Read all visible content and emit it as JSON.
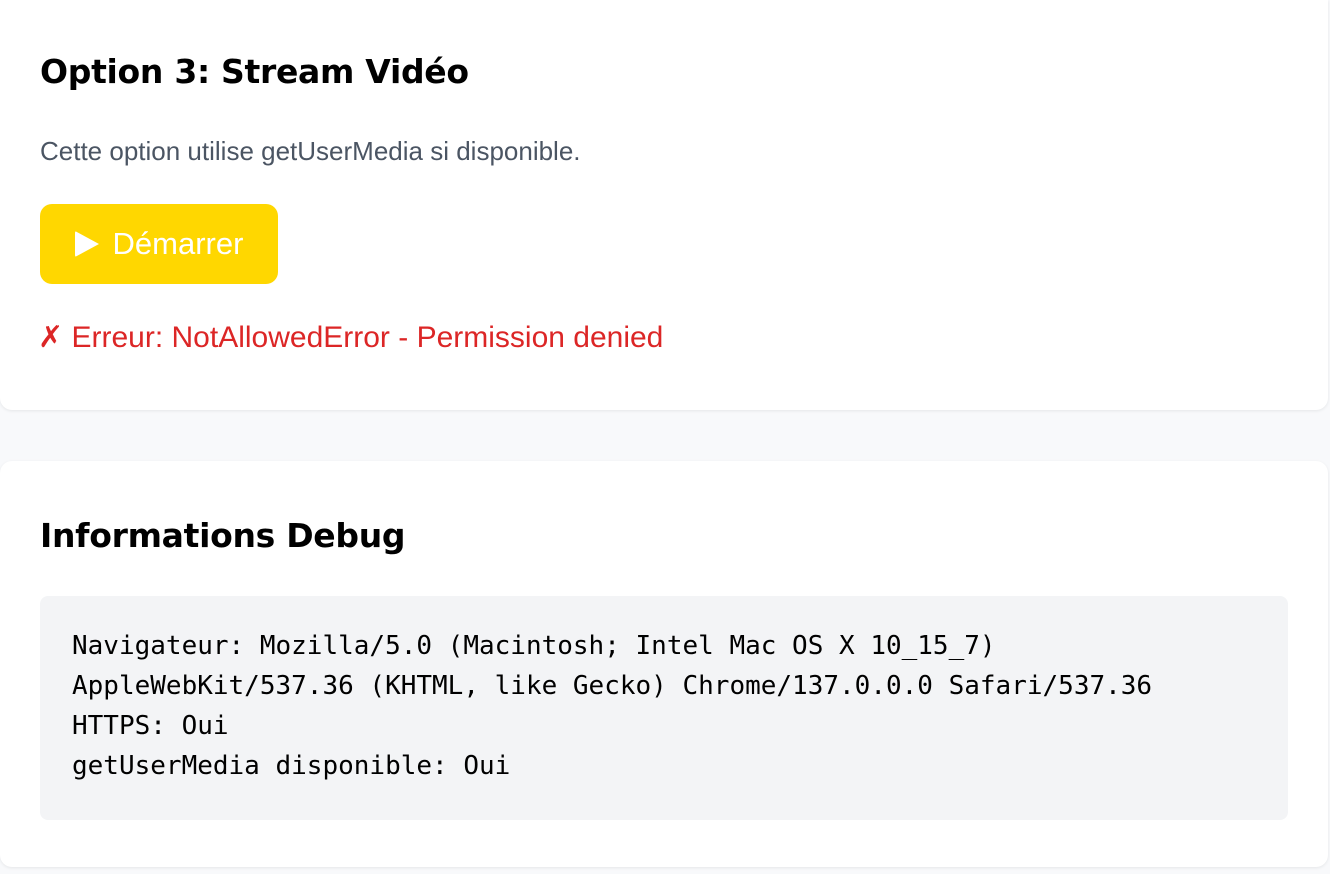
{
  "stream_section": {
    "title": "Option 3: Stream Vidéo",
    "description": "Cette option utilise getUserMedia si disponible.",
    "start_button_label": "Démarrer",
    "error_icon": "✗",
    "error_text": "Erreur: NotAllowedError - Permission denied"
  },
  "debug_section": {
    "title": "Informations Debug",
    "lines": [
      "Navigateur: Mozilla/5.0 (Macintosh; Intel Mac OS X 10_15_7)",
      "AppleWebKit/537.36 (KHTML, like Gecko) Chrome/137.0.0.0 Safari/537.36",
      "HTTPS: Oui",
      "getUserMedia disponible: Oui"
    ]
  },
  "icons": {
    "start_button_icon": "play-icon",
    "error_icon": "cross-icon"
  },
  "colors": {
    "button_background": "#ffd700",
    "button_text": "#ffffff",
    "error_text": "#dc2626",
    "description_text": "#4b5563",
    "debug_background": "#f3f4f6",
    "page_background": "#f8f9fb"
  }
}
